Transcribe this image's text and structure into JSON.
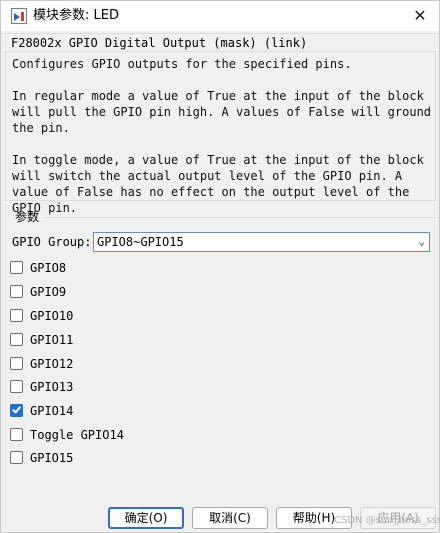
{
  "window": {
    "title": "模块参数: LED",
    "close_glyph": "✕"
  },
  "panel": {
    "title": "F28002x GPIO Digital Output (mask) (link)",
    "description": [
      "Configures GPIO outputs for the specified pins.",
      "In regular mode a value of True at the input of the block will pull the GPIO pin high. A values of False will ground the pin.",
      "In toggle mode, a value of True at the input of the block will switch the actual output level of the GPIO pin. A value of False has no effect on the output level of the GPIO pin."
    ]
  },
  "params": {
    "section_label": "参数",
    "group_label": "GPIO Group:",
    "group_value": "GPIO8~GPIO15",
    "checkboxes": [
      {
        "label": "GPIO8",
        "checked": false
      },
      {
        "label": "GPIO9",
        "checked": false
      },
      {
        "label": "GPIO10",
        "checked": false
      },
      {
        "label": "GPIO11",
        "checked": false
      },
      {
        "label": "GPIO12",
        "checked": false
      },
      {
        "label": "GPIO13",
        "checked": false
      },
      {
        "label": "GPIO14",
        "checked": true
      },
      {
        "label": "Toggle GPIO14",
        "checked": false
      },
      {
        "label": "GPIO15",
        "checked": false
      }
    ]
  },
  "footer": {
    "ok_label": "确定(O)",
    "cancel_label": "取消(C)",
    "help_label": "帮助(H)",
    "apply_label": "应用(A)"
  },
  "watermark": "CSDN @sun_boss_sss"
}
